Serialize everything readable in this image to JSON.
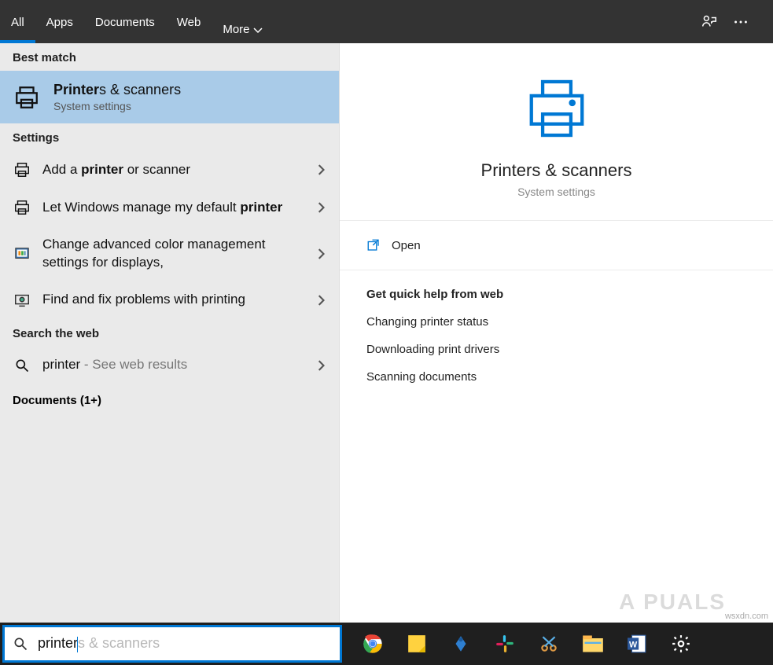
{
  "tabs": {
    "all": "All",
    "apps": "Apps",
    "documents": "Documents",
    "web": "Web",
    "more": "More"
  },
  "left": {
    "best_match_label": "Best match",
    "best_match": {
      "title_bold": "Printer",
      "title_rest": "s & scanners",
      "subtitle": "System settings"
    },
    "settings_label": "Settings",
    "settings": [
      {
        "pre": "Add a ",
        "bold": "printer",
        "post": " or scanner"
      },
      {
        "pre": "Let Windows manage my default ",
        "bold": "printer",
        "post": ""
      },
      {
        "pre": "Change advanced color management settings for displays,",
        "bold": "",
        "post": ""
      },
      {
        "pre": "Find and fix problems with printing",
        "bold": "",
        "post": ""
      }
    ],
    "search_web_label": "Search the web",
    "search_web": {
      "term": "printer",
      "suffix": " - See web results"
    },
    "documents_label": "Documents (1+)"
  },
  "right": {
    "title": "Printers & scanners",
    "subtitle": "System settings",
    "open": "Open",
    "help_label": "Get quick help from web",
    "help_links": [
      "Changing printer status",
      "Downloading print drivers",
      "Scanning documents"
    ]
  },
  "search": {
    "typed": "printer",
    "hint": "s & scanners"
  },
  "watermark": "A  PUALS",
  "wsxdn": "wsxdn.com"
}
